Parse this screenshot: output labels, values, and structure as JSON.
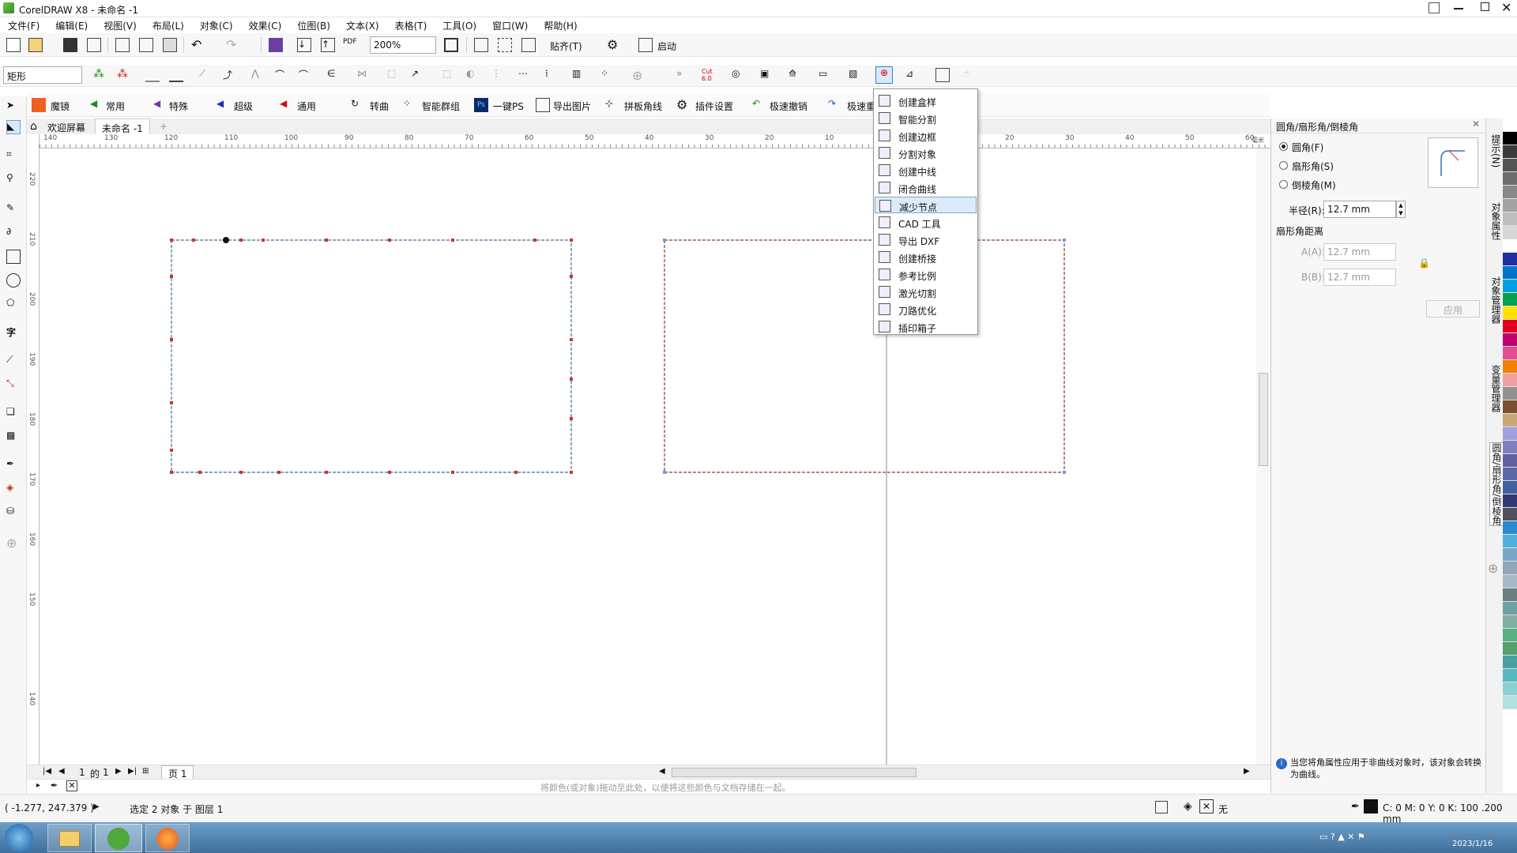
{
  "window": {
    "title": "CorelDRAW X8 - 未命名 -1"
  },
  "menu": [
    "文件(F)",
    "编辑(E)",
    "视图(V)",
    "布局(L)",
    "对象(C)",
    "效果(C)",
    "位图(B)",
    "文本(X)",
    "表格(T)",
    "工具(O)",
    "窗口(W)",
    "帮助(H)"
  ],
  "standard_toolbar": {
    "zoom": "200%",
    "snap_label": "贴齐(T)",
    "launch_label": "启动"
  },
  "property_bar": {
    "shape_type": "矩形"
  },
  "plugin_bar": {
    "items": [
      "魔镜",
      "常用",
      "特殊",
      "超级",
      "通用",
      "转曲",
      "智能群组",
      "一键PS",
      "导出图片",
      "拼板角线",
      "插件设置",
      "极速撤销",
      "极速重"
    ]
  },
  "tabs": {
    "welcome": "欢迎屏幕",
    "document": "未命名 -1"
  },
  "ruler": {
    "h_labels": [
      "140",
      "130",
      "120",
      "110",
      "100",
      "90",
      "80",
      "70",
      "60",
      "50",
      "40",
      "30",
      "20",
      "10",
      "",
      "10",
      "20",
      "30",
      "40",
      "50",
      "60"
    ],
    "h_unit": "毫米",
    "v_labels": [
      "220",
      "210",
      "200",
      "190",
      "180",
      "170",
      "160",
      "150",
      "140"
    ]
  },
  "dropdown": {
    "items": [
      "创建盒样",
      "智能分割",
      "创建边框",
      "分割对象",
      "创建中线",
      "闭合曲线",
      "减少节点",
      "CAD 工具",
      "导出 DXF",
      "创建桥接",
      "参考比例",
      "激光切割",
      "刀路优化",
      "插印箱子"
    ],
    "selected_index": 6
  },
  "docker": {
    "title": "圆角/扇形角/倒棱角",
    "options": [
      "圆角(F)",
      "扇形角(S)",
      "倒棱角(M)"
    ],
    "selected_option": 0,
    "radius_label": "半径(R):",
    "radius_value": "12.7 mm",
    "distance_label": "扇形角距离",
    "a_label": "A(A):",
    "a_value": "12.7 mm",
    "b_label": "B(B):",
    "b_value": "12.7 mm",
    "apply_label": "应用",
    "info_text": "当您将角属性应用于非曲线对象时，该对象会转换为曲线。"
  },
  "docker_tabs": [
    "提示(N)",
    "对象属性",
    "对象管理器",
    "变量管理器",
    "圆角/扇形角/倒棱角"
  ],
  "page_nav": {
    "current": "1",
    "of_label": "的",
    "total": "1",
    "page_tab": "页 1"
  },
  "hint_text": "将颜色(或对象)拖动至此处，以便将这些颜色与文档存储在一起。",
  "status": {
    "coords": "( -1.277, 247.379 )",
    "selection": "选定 2 对象 于 图层 1",
    "fill_label": "无",
    "outline_info": "C: 0 M: 0 Y: 0 K: 100 .200 mm"
  },
  "taskbar": {
    "date": "2023/1/16"
  },
  "palette_colors": [
    "#ffffff",
    "#000000",
    "#3a3a3a",
    "#555555",
    "#6d6d6d",
    "#888888",
    "#a2a2a2",
    "#bdbdbd",
    "#d7d7d7",
    "#ffffff",
    "#1e2fa0",
    "#0074c8",
    "#00a0e0",
    "#00a050",
    "#ffe000",
    "#e0001e",
    "#c0006e",
    "#e05090",
    "#f08000",
    "#f0a0a0",
    "#909090",
    "#7a5030",
    "#c8a878",
    "#a0a0e0",
    "#8080c0",
    "#6060a0",
    "#5a6aa8",
    "#4060a0",
    "#303878",
    "#505060",
    "#2a8ad0",
    "#50b0e0",
    "#78a8c8",
    "#90a8b8",
    "#a8b8c8",
    "#6a8080",
    "#70a0a0",
    "#80b0a0",
    "#5ab080",
    "#50a070",
    "#4aa0a0",
    "#5ab8c0",
    "#8ad0d0",
    "#b0e0e0"
  ]
}
